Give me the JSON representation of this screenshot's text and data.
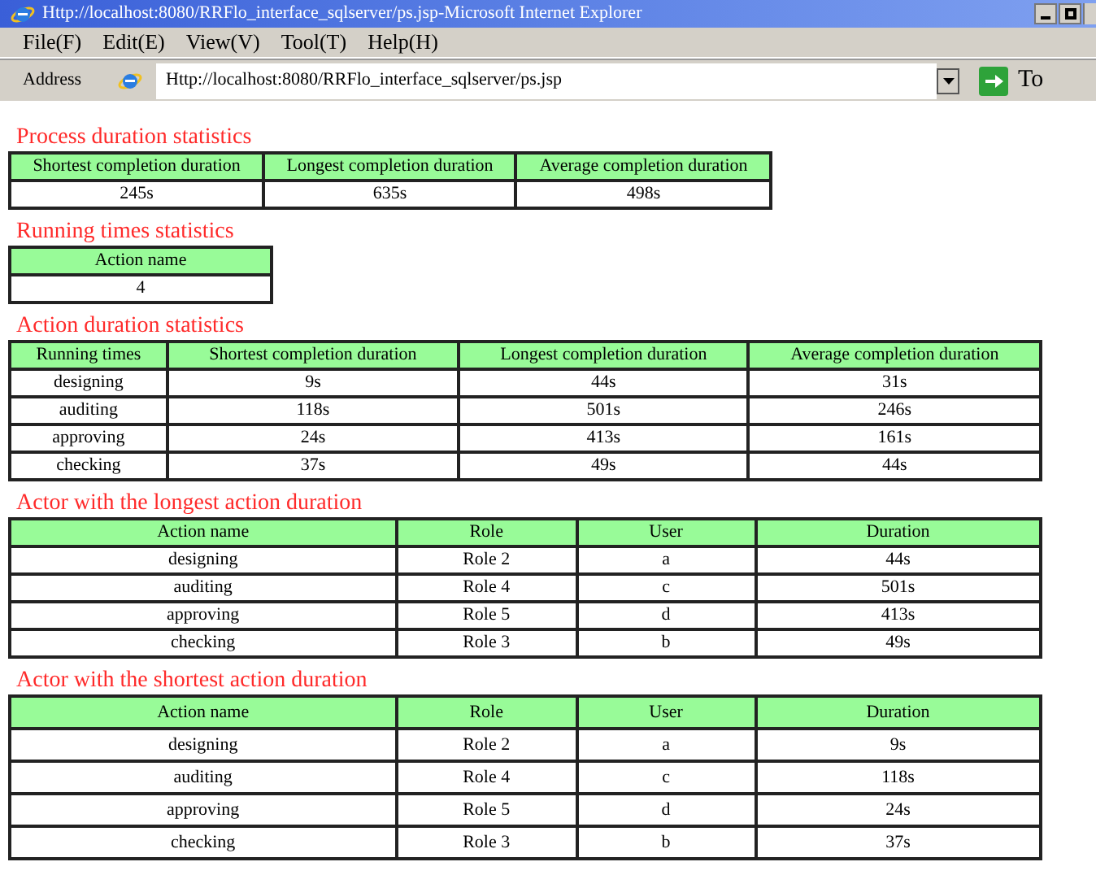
{
  "window": {
    "title": "Http://localhost:8080/RRFlo_interface_sqlserver/ps.jsp-Microsoft Internet Explorer"
  },
  "menu": [
    "File(F)",
    "Edit(E)",
    "View(V)",
    "Tool(T)",
    "Help(H)"
  ],
  "address_bar": {
    "label": "Address",
    "value": "Http://localhost:8080/RRFlo_interface_sqlserver/ps.jsp",
    "go": "To"
  },
  "sections": [
    {
      "title": "Process duration statistics",
      "columns": [
        "Shortest  completion duration",
        "Longest  completion duration",
        "Average  completion duration"
      ],
      "rows": [
        [
          "245s",
          "635s",
          "498s"
        ]
      ]
    },
    {
      "title": "Running times statistics",
      "columns": [
        "Action name"
      ],
      "rows": [
        [
          "4"
        ]
      ]
    },
    {
      "title": "Action duration statistics",
      "columns": [
        "Running times",
        "Shortest  completion duration",
        "Longest  completion duration",
        "Average  completion duration"
      ],
      "rows": [
        [
          "designing",
          "9s",
          "44s",
          "31s"
        ],
        [
          "auditing",
          "118s",
          "501s",
          "246s"
        ],
        [
          "approving",
          "24s",
          "413s",
          "161s"
        ],
        [
          "checking",
          "37s",
          "49s",
          "44s"
        ]
      ]
    },
    {
      "title": "Actor with the longest action duration",
      "columns": [
        "Action name",
        "Role",
        "User",
        "Duration"
      ],
      "rows": [
        [
          "designing",
          "Role 2",
          "a",
          "44s"
        ],
        [
          "auditing",
          "Role 4",
          "c",
          "501s"
        ],
        [
          "approving",
          "Role 5",
          "d",
          "413s"
        ],
        [
          "checking",
          "Role 3",
          "b",
          "49s"
        ]
      ]
    },
    {
      "title": "Actor with the shortest action duration",
      "columns": [
        "Action name",
        "Role",
        "User",
        "Duration"
      ],
      "rows": [
        [
          "designing",
          "Role 2",
          "a",
          "9s"
        ],
        [
          "auditing",
          "Role 4",
          "c",
          "118s"
        ],
        [
          "approving",
          "Role 5",
          "d",
          "24s"
        ],
        [
          "checking",
          "Role 3",
          "b",
          "37s"
        ]
      ]
    }
  ]
}
